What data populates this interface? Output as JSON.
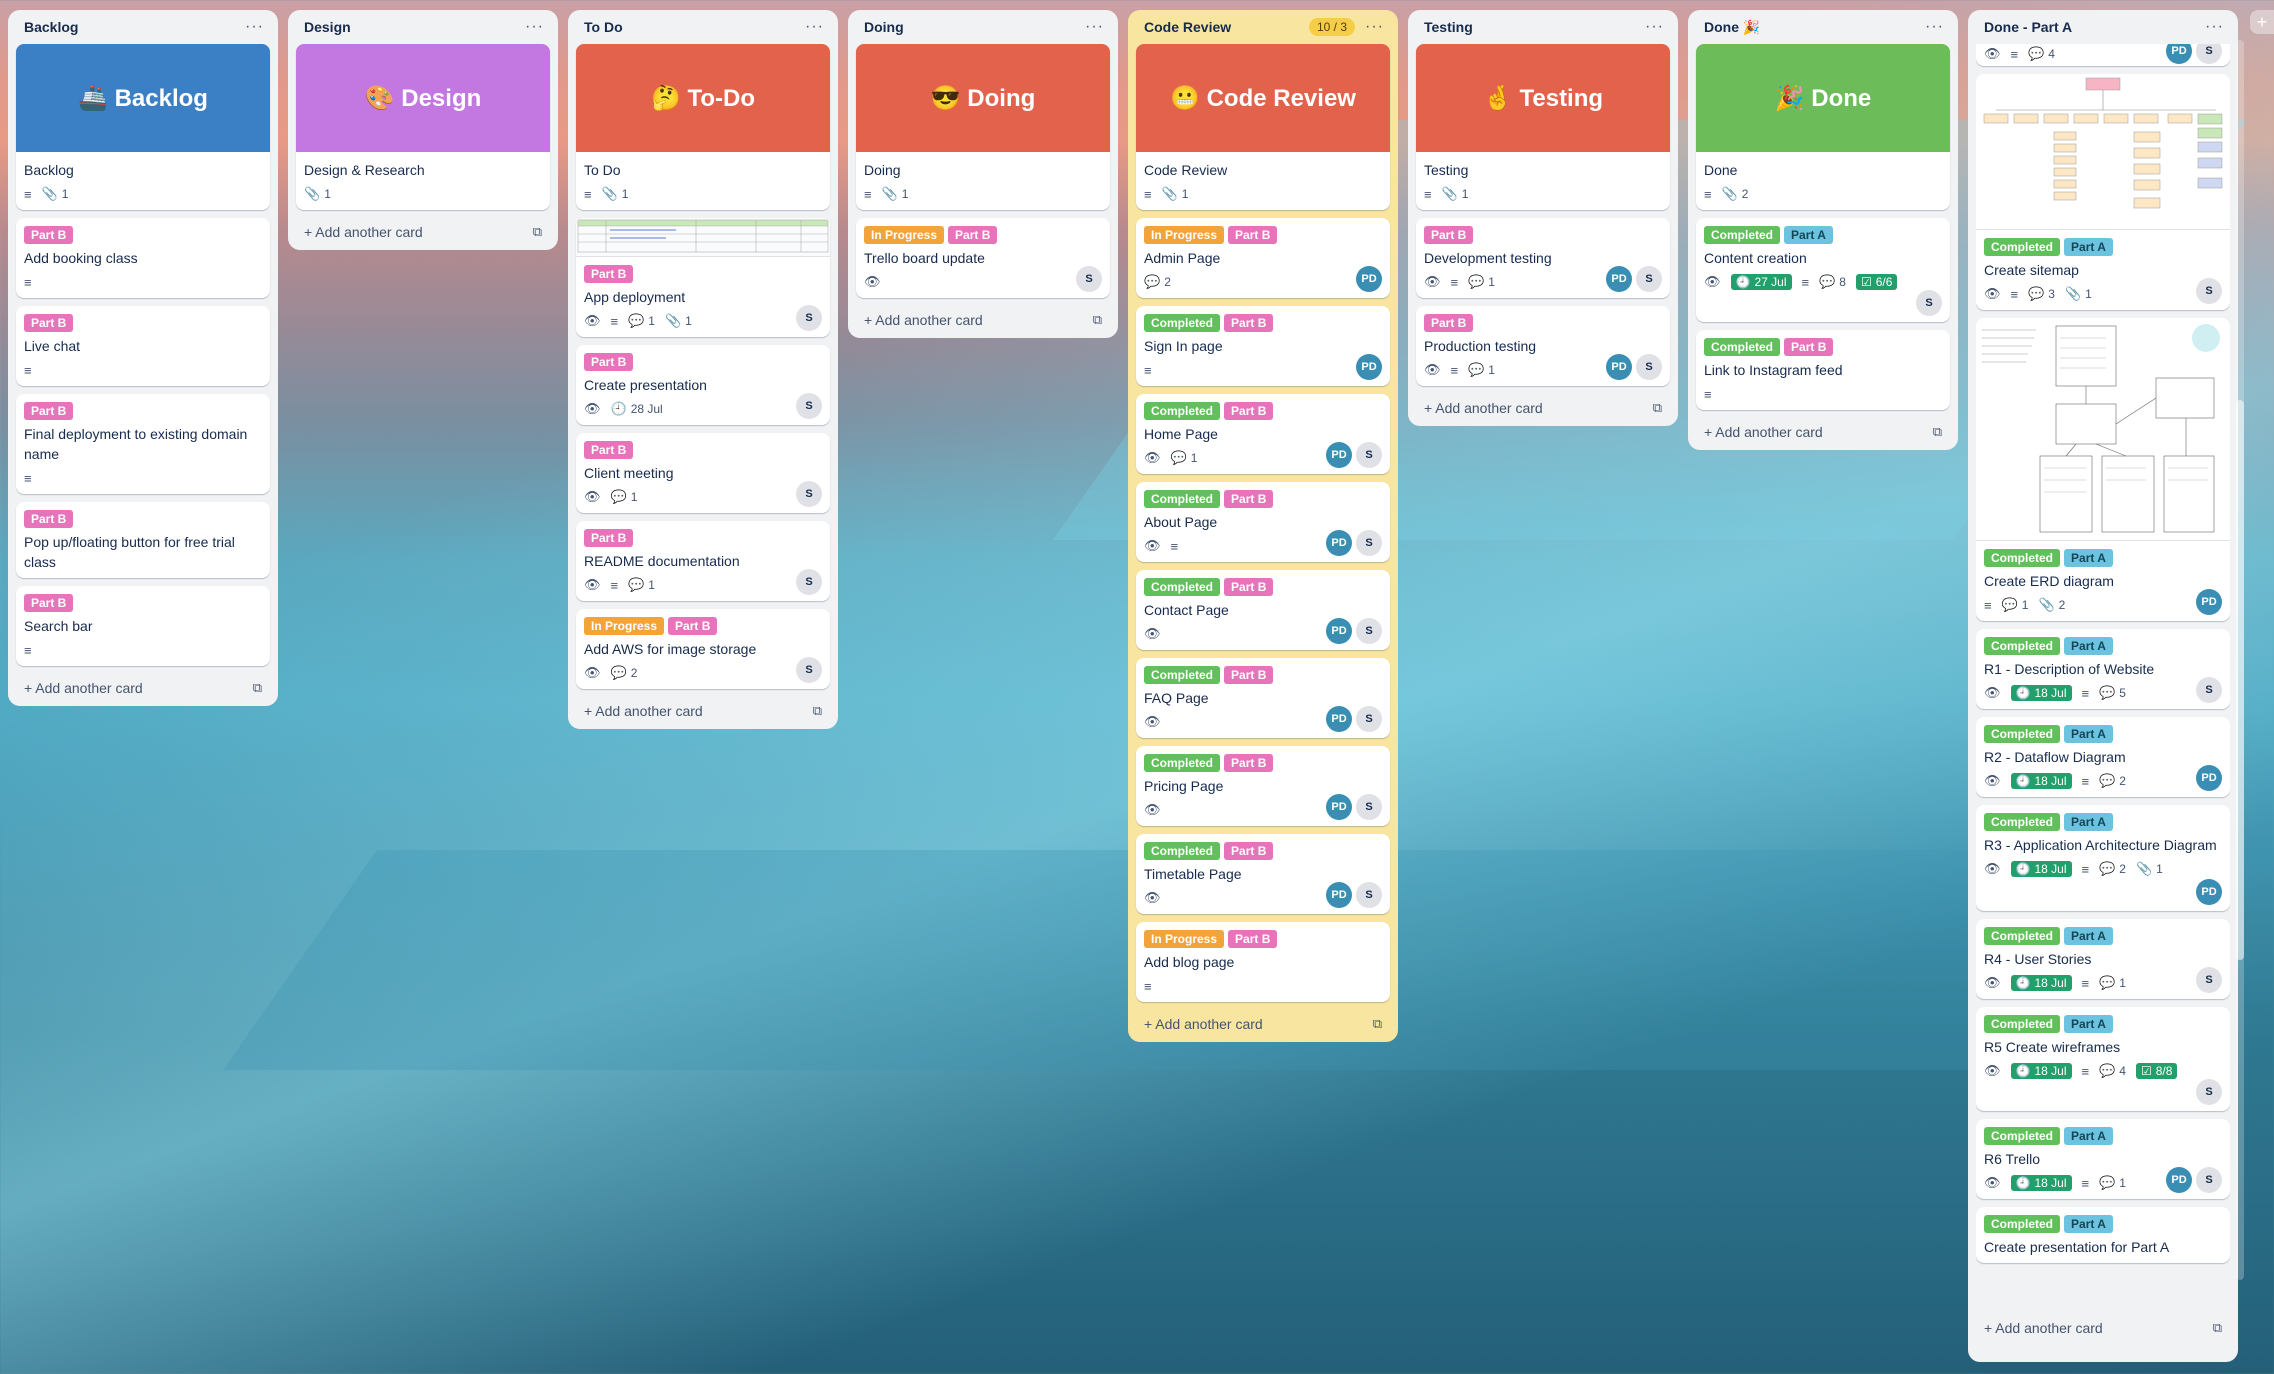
{
  "lists": {
    "backlog": {
      "title": "Backlog",
      "cover_text": "🚢 Backlog",
      "cover_color": "#3b7fc4",
      "cards": {
        "c0": {
          "title": "Backlog",
          "attach": "1"
        },
        "c1": {
          "label": "Part B",
          "title": "Add booking class"
        },
        "c2": {
          "label": "Part B",
          "title": "Live chat"
        },
        "c3": {
          "label": "Part B",
          "title": "Final deployment to existing domain name"
        },
        "c4": {
          "label": "Part B",
          "title": "Pop up/floating button for free trial class"
        },
        "c5": {
          "label": "Part B",
          "title": "Search bar"
        }
      },
      "add": "Add another card"
    },
    "design": {
      "title": "Design",
      "cover_text": "🎨 Design",
      "cover_color": "#c377e0",
      "cards": {
        "c0": {
          "title": "Design & Research",
          "attach": "1"
        }
      },
      "add": "Add another card"
    },
    "todo": {
      "title": "To Do",
      "cover_text": "🤔 To-Do",
      "cover_color": "#e2624b",
      "cards": {
        "c0": {
          "title": "To Do",
          "attach": "1"
        },
        "c1": {
          "label": "Part B",
          "title": "App deployment",
          "comments": "1",
          "attach": "1"
        },
        "c2": {
          "label": "Part B",
          "title": "Create presentation",
          "date": "28 Jul"
        },
        "c3": {
          "label": "Part B",
          "title": "Client meeting",
          "comments": "1"
        },
        "c4": {
          "label": "Part B",
          "title": "README documentation",
          "comments": "1"
        },
        "c5": {
          "label1": "In Progress",
          "label2": "Part B",
          "title": "Add AWS for image storage",
          "comments": "2"
        }
      },
      "add": "Add another card"
    },
    "doing": {
      "title": "Doing",
      "cover_text": "😎 Doing",
      "cover_color": "#e2624b",
      "cards": {
        "c0": {
          "title": "Doing",
          "attach": "1"
        },
        "c1": {
          "label1": "In Progress",
          "label2": "Part B",
          "title": "Trello board update"
        }
      },
      "add": "Add another card"
    },
    "review": {
      "title": "Code Review",
      "count": "10 / 3",
      "cover_text": "😬 Code Review",
      "cover_color": "#e2624b",
      "cards": {
        "c0": {
          "title": "Code Review",
          "attach": "1"
        },
        "c1": {
          "label1": "In Progress",
          "label2": "Part B",
          "title": "Admin Page",
          "comments": "2"
        },
        "c2": {
          "label1": "Completed",
          "label2": "Part B",
          "title": "Sign In page"
        },
        "c3": {
          "label1": "Completed",
          "label2": "Part B",
          "title": "Home Page",
          "comments": "1"
        },
        "c4": {
          "label1": "Completed",
          "label2": "Part B",
          "title": "About Page"
        },
        "c5": {
          "label1": "Completed",
          "label2": "Part B",
          "title": "Contact Page"
        },
        "c6": {
          "label1": "Completed",
          "label2": "Part B",
          "title": "FAQ Page"
        },
        "c7": {
          "label1": "Completed",
          "label2": "Part B",
          "title": "Pricing Page"
        },
        "c8": {
          "label1": "Completed",
          "label2": "Part B",
          "title": "Timetable Page"
        },
        "c9": {
          "label1": "In Progress",
          "label2": "Part B",
          "title": "Add blog page"
        }
      },
      "add": "Add another card"
    },
    "testing": {
      "title": "Testing",
      "cover_text": "🤞 Testing",
      "cover_color": "#e2624b",
      "cards": {
        "c0": {
          "title": "Testing",
          "attach": "1"
        },
        "c1": {
          "label": "Part B",
          "title": "Development testing",
          "comments": "1"
        },
        "c2": {
          "label": "Part B",
          "title": "Production testing",
          "comments": "1"
        }
      },
      "add": "Add another card"
    },
    "done": {
      "title": "Done 🎉",
      "cover_text": "🎉 Done",
      "cover_color": "#6cbd5a",
      "cards": {
        "c0": {
          "title": "Done",
          "attach": "2"
        },
        "c1": {
          "label1": "Completed",
          "label2": "Part A",
          "title": "Content creation",
          "date": "27 Jul",
          "comments": "8",
          "checklist": "6/6"
        },
        "c2": {
          "label1": "Completed",
          "label2": "Part B",
          "title": "Link to Instagram feed"
        }
      },
      "add": "Add another card"
    },
    "donea": {
      "title": "Done - Part A",
      "cards": {
        "c0": {
          "comments": "4"
        },
        "c1": {
          "label1": "Completed",
          "label2": "Part A",
          "title": "Create sitemap",
          "comments": "3",
          "attach": "1"
        },
        "c2": {
          "label1": "Completed",
          "label2": "Part A",
          "title": "Create ERD diagram",
          "comments": "1",
          "attach": "2"
        },
        "c3": {
          "label1": "Completed",
          "label2": "Part A",
          "title": "R1 - Description of Website",
          "date": "18 Jul",
          "comments": "5"
        },
        "c4": {
          "label1": "Completed",
          "label2": "Part A",
          "title": "R2 - Dataflow Diagram",
          "date": "18 Jul",
          "comments": "2"
        },
        "c5": {
          "label1": "Completed",
          "label2": "Part A",
          "title": "R3 - Application Architecture Diagram",
          "date": "18 Jul",
          "comments": "2",
          "attach": "1"
        },
        "c6": {
          "label1": "Completed",
          "label2": "Part A",
          "title": "R4 - User Stories",
          "date": "18 Jul",
          "comments": "1"
        },
        "c7": {
          "label1": "Completed",
          "label2": "Part A",
          "title": "R5 Create wireframes",
          "date": "18 Jul",
          "comments": "4",
          "checklist": "8/8"
        },
        "c8": {
          "label1": "Completed",
          "label2": "Part A",
          "title": "R6 Trello",
          "date": "18 Jul",
          "comments": "1"
        },
        "c9": {
          "label1": "Completed",
          "label2": "Part A",
          "title": "Create presentation for Part A"
        }
      },
      "add": "Add another card"
    }
  },
  "avatars": {
    "pd": "PD",
    "s": "S"
  },
  "colors": {
    "partB": "#e774bb",
    "partA": "#6cc3e0",
    "completed": "#60c15a",
    "in_progress": "#f2a33a"
  }
}
